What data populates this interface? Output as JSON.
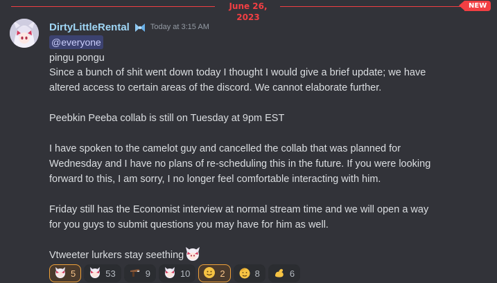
{
  "divider": {
    "date": "June 26, 2023",
    "new_badge": "NEW"
  },
  "message": {
    "author": "DirtyLittleRental",
    "author_badge_icon": "ribbon-icon",
    "timestamp": "Today at 3:15 AM",
    "mention": "@everyone",
    "lines": [
      "pingu pongu",
      "Since a bunch of shit went down today I thought I would give a brief update; we have",
      "altered access to certain areas of the discord. We cannot elaborate further.",
      "",
      "Peebkin Peeba collab is still on Tuesday at 9pm EST",
      "",
      "I have spoken to the camelot guy and cancelled the collab that was planned for",
      "Wednesday and I have no plans of re-scheduling this in the future. If you were looking",
      "forward to this, I am sorry, I no longer feel comfortable interacting with him.",
      "",
      "Friday still has the Economist interview at normal stream time and we will open a way",
      "for you guys to submit questions you may have for him as well.",
      "",
      "Vtweeter lurkers stay seething"
    ],
    "trailing_emoji": "custom-character-emoji"
  },
  "reactions": [
    {
      "icon": "character-emoji",
      "count": "5",
      "reacted": true,
      "style": "orange"
    },
    {
      "icon": "character-emoji",
      "count": "53",
      "reacted": false
    },
    {
      "icon": "weapon-emoji",
      "count": "9",
      "reacted": false
    },
    {
      "icon": "character-emoji",
      "count": "10",
      "reacted": false
    },
    {
      "icon": "smiling-face-emoji",
      "count": "2",
      "reacted": true,
      "style": "orange"
    },
    {
      "icon": "saluting-face-emoji",
      "count": "8",
      "reacted": false
    },
    {
      "icon": "flexed-biceps-emoji",
      "count": "6",
      "reacted": false
    }
  ],
  "colors": {
    "background": "#323339",
    "divider": "#f23f43",
    "username": "#9fd6f5",
    "mention_bg": "#3c4270"
  }
}
